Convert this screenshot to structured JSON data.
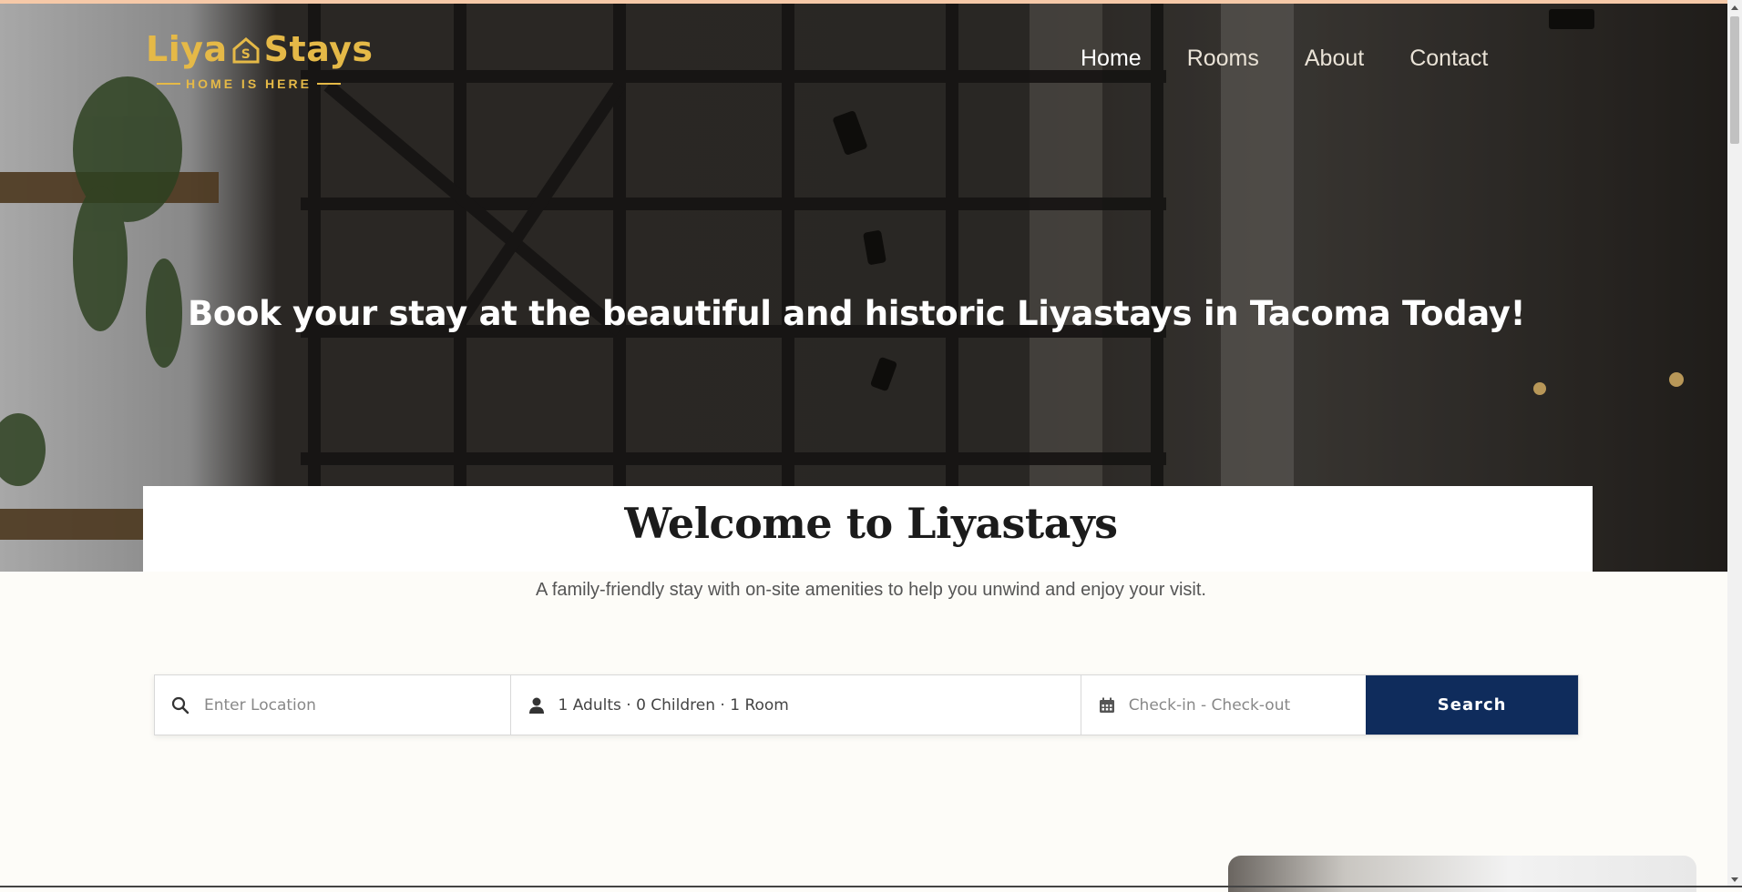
{
  "brand": {
    "logo_name_left": "Liya",
    "logo_name_right": "Stays",
    "tagline": "HOME IS HERE",
    "gold": "#e5b947"
  },
  "nav": {
    "items": [
      {
        "label": "Home",
        "active": true
      },
      {
        "label": "Rooms",
        "active": false
      },
      {
        "label": "About",
        "active": false
      },
      {
        "label": "Contact",
        "active": false
      }
    ]
  },
  "hero": {
    "heading": "Book your stay at the beautiful and historic Liyastays in Tacoma Today!"
  },
  "welcome": {
    "title": "Welcome to Liyastays",
    "subtitle": "A family-friendly stay with on-site amenities to  help you unwind and enjoy your visit."
  },
  "search": {
    "location_placeholder": "Enter Location",
    "guests_text": "1 Adults · 0 Children · 1 Room",
    "dates_placeholder": "Check-in - Check-out",
    "button_label": "Search",
    "button_color": "#0f2c5c"
  }
}
